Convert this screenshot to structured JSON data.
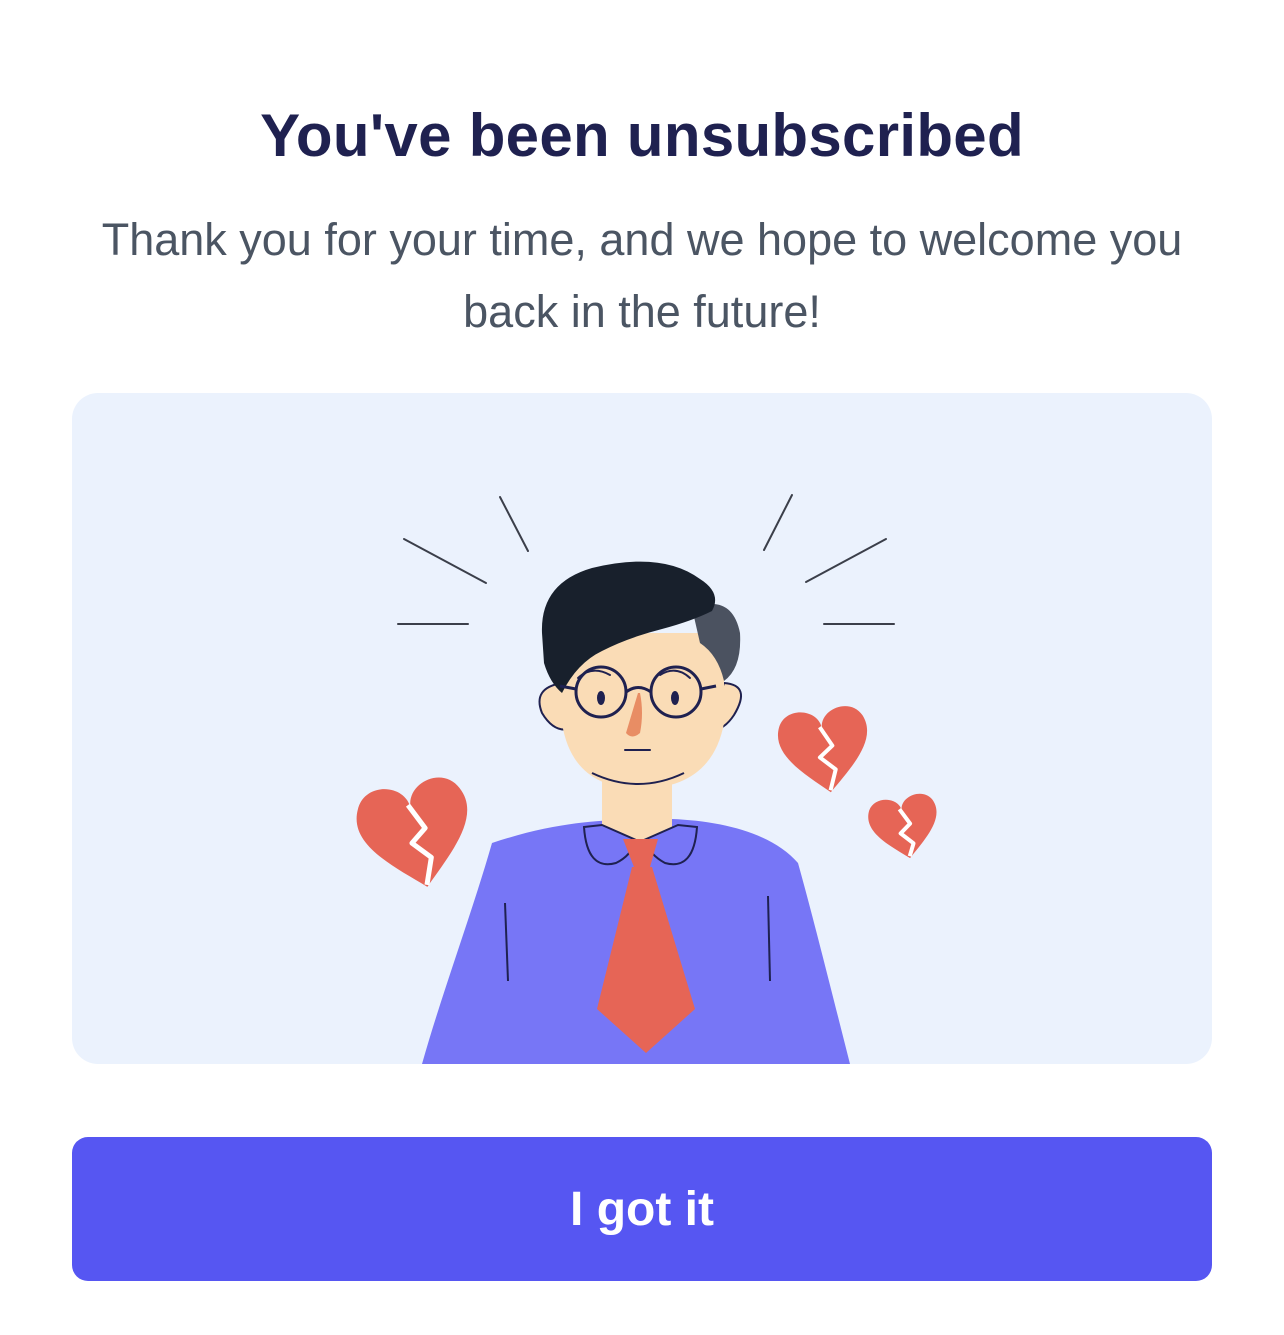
{
  "dialog": {
    "title": "You've been unsubscribed",
    "message": "Thank you for your time, and we hope to welcome you back in the future!",
    "illustration_icon": "sad-man-broken-hearts-illustration",
    "confirm_label": "I got it"
  },
  "colors": {
    "title": "#1f2150",
    "message": "#4b5563",
    "illustration_bg": "#ebf2fd",
    "button_bg": "#5656f2",
    "button_text": "#ffffff",
    "shirt": "#7776f6",
    "tie": "#e66556",
    "hearts": "#e66556",
    "skin": "#fadcb6",
    "hair": "#18202c"
  }
}
